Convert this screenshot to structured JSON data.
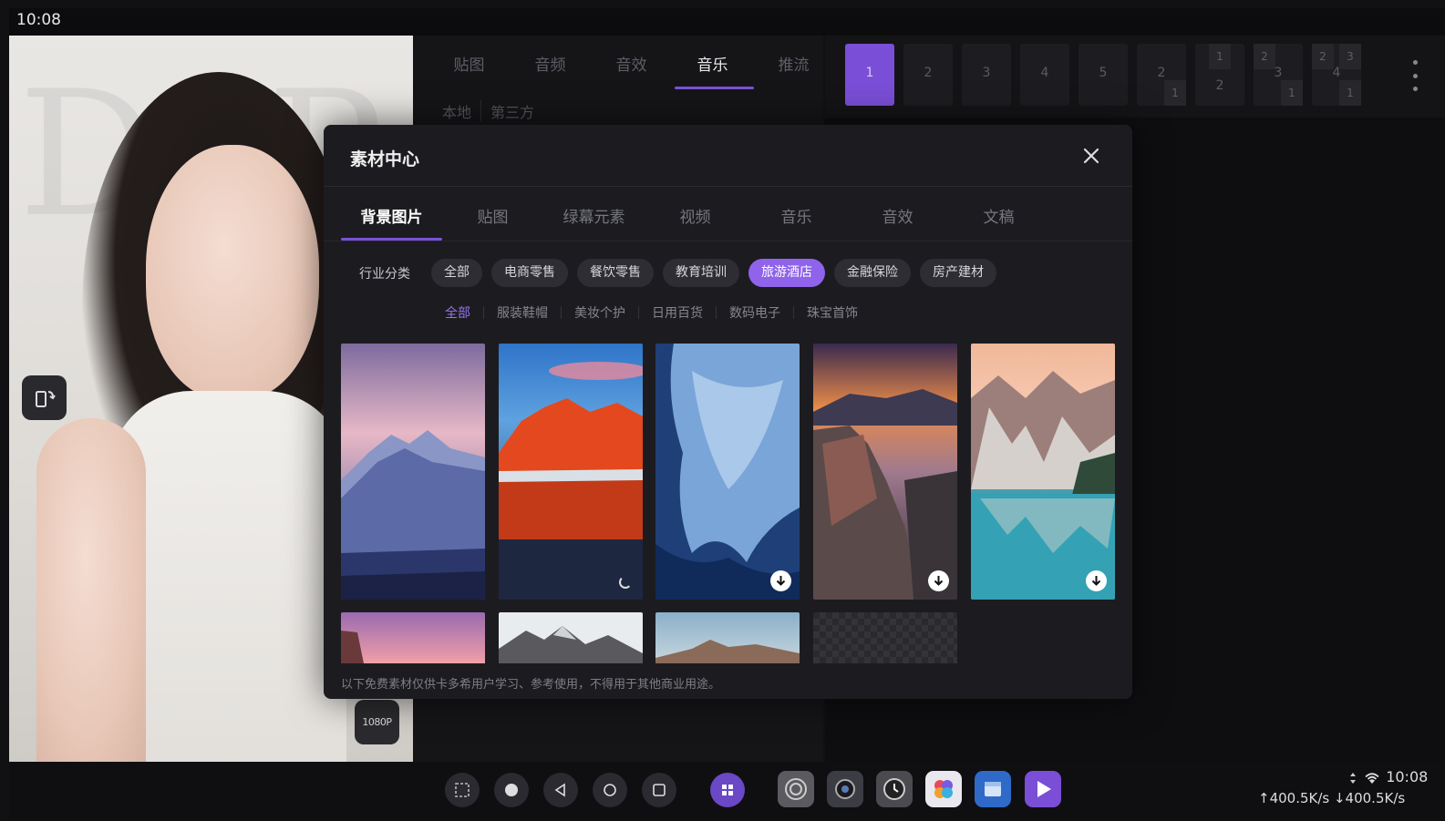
{
  "status": {
    "time": "10:08"
  },
  "preview": {
    "backdrop_text": "D  P",
    "resolution_badge": "1080P"
  },
  "top_tabs": [
    {
      "label": "贴图",
      "active": false
    },
    {
      "label": "音频",
      "active": false
    },
    {
      "label": "音效",
      "active": false
    },
    {
      "label": "音乐",
      "active": true
    },
    {
      "label": "推流",
      "active": false
    }
  ],
  "source_tabs": [
    "本地",
    "第三方"
  ],
  "scenes": {
    "singles": [
      "1",
      "2",
      "3",
      "4",
      "5"
    ],
    "layout_a": [
      "2",
      "1"
    ],
    "layout_b": [
      "1",
      "2"
    ],
    "layout_c": [
      "2",
      "3",
      "1"
    ],
    "layout_d": [
      "2",
      "3",
      "4",
      "1"
    ]
  },
  "dialog": {
    "title": "素材中心",
    "tabs": [
      {
        "label": "背景图片",
        "active": true
      },
      {
        "label": "贴图",
        "active": false
      },
      {
        "label": "绿幕元素",
        "active": false
      },
      {
        "label": "视频",
        "active": false
      },
      {
        "label": "音乐",
        "active": false
      },
      {
        "label": "音效",
        "active": false
      },
      {
        "label": "文稿",
        "active": false
      }
    ],
    "category_label": "行业分类",
    "categories": [
      {
        "label": "全部",
        "active": false
      },
      {
        "label": "电商零售",
        "active": false
      },
      {
        "label": "餐饮零售",
        "active": false
      },
      {
        "label": "教育培训",
        "active": false
      },
      {
        "label": "旅游酒店",
        "active": true
      },
      {
        "label": "金融保险",
        "active": false
      },
      {
        "label": "房产建材",
        "active": false
      }
    ],
    "subcategories": [
      {
        "label": "全部",
        "active": true
      },
      {
        "label": "服装鞋帽",
        "active": false
      },
      {
        "label": "美妆个护",
        "active": false
      },
      {
        "label": "日用百货",
        "active": false
      },
      {
        "label": "数码电子",
        "active": false
      },
      {
        "label": "珠宝首饰",
        "active": false
      }
    ],
    "disclaimer": "以下免费素材仅供卡多希用户学习、参考使用，不得用于其他商业用途。"
  },
  "system": {
    "time": "10:08",
    "net_speed": "↑400.5K/s ↓400.5K/s"
  },
  "colors": {
    "accent": "#7a52d6",
    "chip_active": "#8f63ea",
    "dialog_bg": "#1c1c20"
  }
}
